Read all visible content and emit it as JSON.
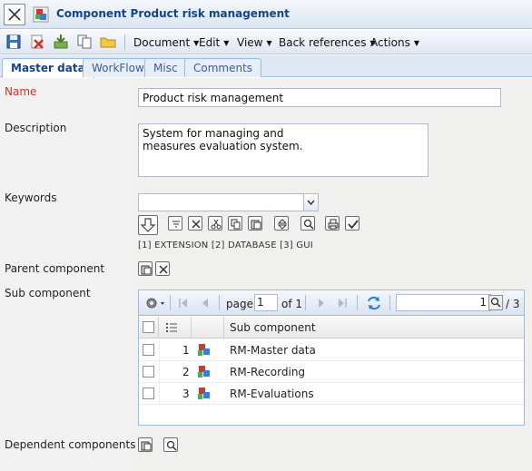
{
  "window": {
    "title": "Component Product risk management"
  },
  "toolbar": {
    "menus": [
      "Document",
      "Edit",
      "View",
      "Back references",
      "Actions"
    ]
  },
  "tabs": [
    "Master data",
    "WorkFlow",
    "Misc",
    "Comments"
  ],
  "form": {
    "name_label": "Name",
    "name_value": "Product risk management",
    "description_label": "Description",
    "description_value": "System for managing and\nmeasures evaluation system.",
    "keywords_label": "Keywords",
    "keywords_value": "",
    "keywords_list": "[1] EXTENSION [2] DATABASE [3] GUI",
    "parent_label": "Parent component",
    "sub_label": "Sub component",
    "dependent_label": "Dependent components"
  },
  "grid": {
    "page_label": "page",
    "page_value": "1",
    "of_label": "of 1",
    "search_value": "1",
    "count_label": "/ 3",
    "column_header": "Sub component",
    "rows": [
      {
        "num": "1",
        "name": "RM-Master data"
      },
      {
        "num": "2",
        "name": "RM-Recording"
      },
      {
        "num": "3",
        "name": "RM-Evaluations"
      }
    ]
  }
}
